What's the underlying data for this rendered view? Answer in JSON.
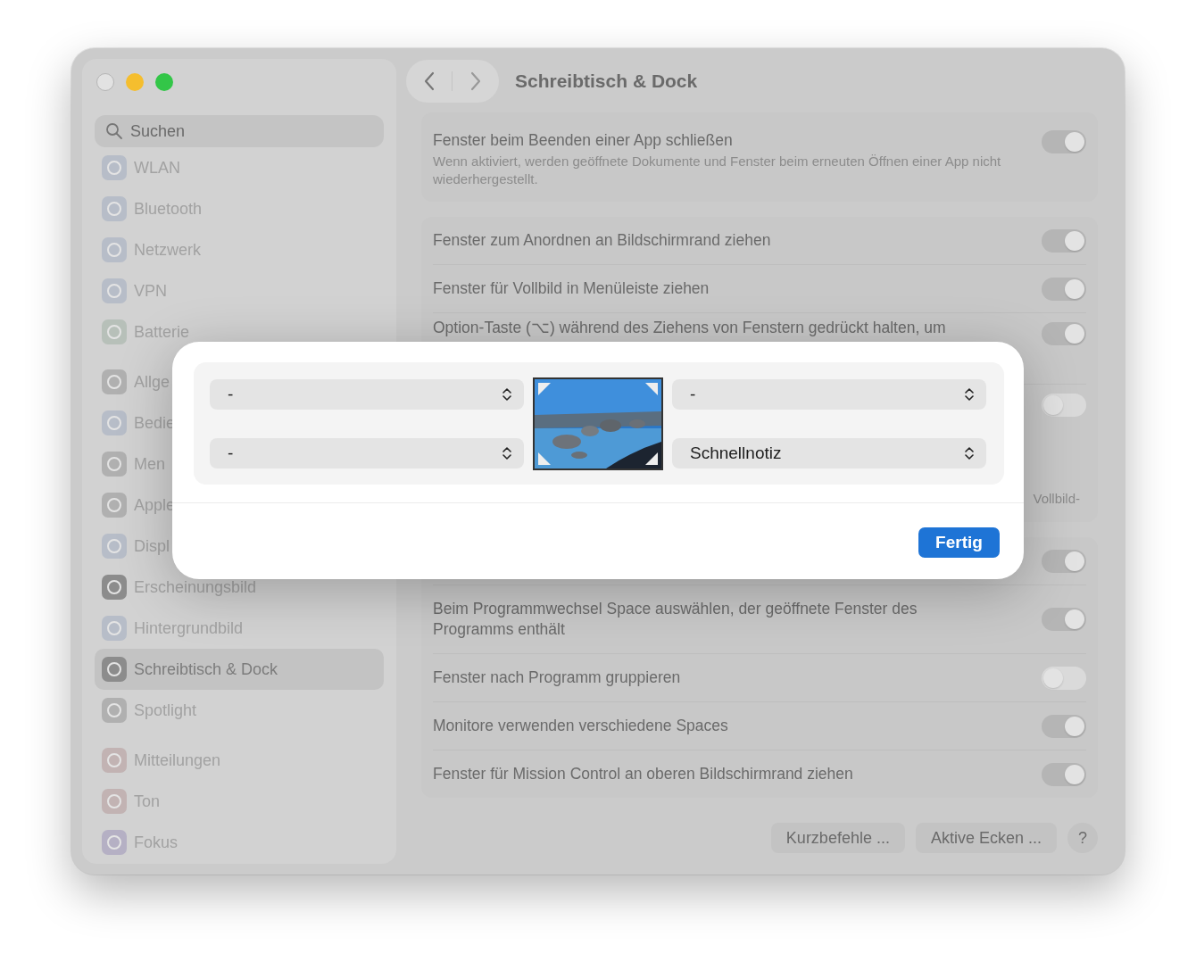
{
  "window": {
    "title": "Schreibtisch & Dock"
  },
  "search": {
    "placeholder": "Suchen"
  },
  "sidebar": {
    "sections": [
      {
        "items": [
          {
            "label": "WLAN",
            "selected": false,
            "color": "#b7bdc8"
          },
          {
            "label": "Bluetooth",
            "selected": false,
            "color": "#b7bdc8"
          },
          {
            "label": "Netzwerk",
            "selected": false,
            "color": "#b7bdc8"
          },
          {
            "label": "VPN",
            "selected": false,
            "color": "#b7bdc8"
          },
          {
            "label": "Batterie",
            "selected": false,
            "color": "#b7c0b9"
          }
        ]
      },
      {
        "items": [
          {
            "label": "Allge",
            "selected": false,
            "color": "#b0b0b0"
          },
          {
            "label": "Bedie",
            "selected": false,
            "color": "#b7bdc8"
          },
          {
            "label": "Men",
            "selected": false,
            "color": "#b0b0b0"
          },
          {
            "label": "Apple",
            "selected": false,
            "color": "#b0b0b0"
          },
          {
            "label": "Displ",
            "selected": false,
            "color": "#b7bdc8"
          },
          {
            "label": "Erscheinungsbild",
            "selected": false,
            "color": "#8c8c8c"
          },
          {
            "label": "Hintergrundbild",
            "selected": false,
            "color": "#b7bdc8"
          },
          {
            "label": "Schreibtisch & Dock",
            "selected": true,
            "color": "#8c8c8c"
          },
          {
            "label": "Spotlight",
            "selected": false,
            "color": "#b0b0b0"
          }
        ]
      },
      {
        "items": [
          {
            "label": "Mitteilungen",
            "selected": false,
            "color": "#c2b3b3"
          },
          {
            "label": "Ton",
            "selected": false,
            "color": "#c2b3b3"
          },
          {
            "label": "Fokus",
            "selected": false,
            "color": "#b5b0c4"
          }
        ]
      }
    ]
  },
  "groups": [
    {
      "rows": [
        {
          "label": "Fenster beim Beenden einer App schließen",
          "description": "Wenn aktiviert, werden geöffnete Dokumente und Fenster beim erneuten Öffnen einer App nicht wiederhergestellt.",
          "on": true
        }
      ]
    },
    {
      "rows": [
        {
          "label": "Fenster zum Anordnen an Bildschirmrand ziehen",
          "on": true
        },
        {
          "label": "Fenster für Vollbild in Menüleiste ziehen",
          "on": true
        },
        {
          "label": "Option-Taste (⌥) während des Ziehens von Fenstern gedrückt halten, um",
          "on": true
        },
        {
          "note": "Vollbild-",
          "on": false
        }
      ]
    },
    {
      "rows": [
        {
          "on": true
        },
        {
          "label": "Beim Programmwechsel Space auswählen, der geöffnete Fenster des Programms enthält",
          "on": true
        },
        {
          "label": "Fenster nach Programm gruppieren",
          "on": false
        },
        {
          "label": "Monitore verwenden verschiedene Spaces",
          "on": true
        },
        {
          "label": "Fenster für Mission Control an oberen Bildschirmrand ziehen",
          "on": true
        }
      ]
    }
  ],
  "buttons": [
    "Kurzbefehle ...",
    "Aktive Ecken ...",
    "?"
  ],
  "hot_corners_dialog": {
    "corners": [
      {
        "value": "-"
      },
      {
        "value": "-"
      },
      {
        "value": "-"
      },
      {
        "value": "Schnellnotiz"
      }
    ],
    "done_button": "Fertig"
  }
}
